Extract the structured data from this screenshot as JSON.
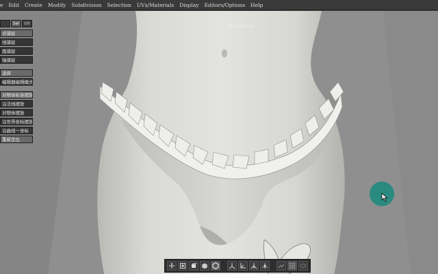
{
  "menubar": {
    "items": [
      "e",
      "Edit",
      "Create",
      "Modify",
      "Subdivision",
      "Selection",
      "UVs/Materials",
      "Display",
      "Editors/Options",
      "Help"
    ]
  },
  "viewport": {
    "label": "Perspective"
  },
  "leftpanel": {
    "mode_tabs": [
      "",
      "Sel",
      "UV"
    ],
    "group1": [
      "点捕捉",
      "线捕捉",
      "面捕捉",
      "轴捕捉"
    ],
    "group2": [
      "选择",
      "编辑器编辑模式"
    ],
    "group3": [
      "对物体标准摆放",
      "沿法线摆放",
      "对物体摆放",
      "沿世界坐标摆放",
      "沿曲线一坐标",
      "重新定位"
    ]
  },
  "shelf": {
    "icons": [
      "move-icon",
      "scale-icon",
      "rotate-icon",
      "cube-icon",
      "hexagon-icon",
      "axis-icon",
      "pivot-icon",
      "tripod-icon",
      "joint-icon",
      "dots-icon",
      "grid-icon",
      "lasso-icon"
    ]
  },
  "colors": {
    "accent": "#2b8a80",
    "viewport_bg": "#8e8e8e",
    "model": "#e6e6e2"
  }
}
